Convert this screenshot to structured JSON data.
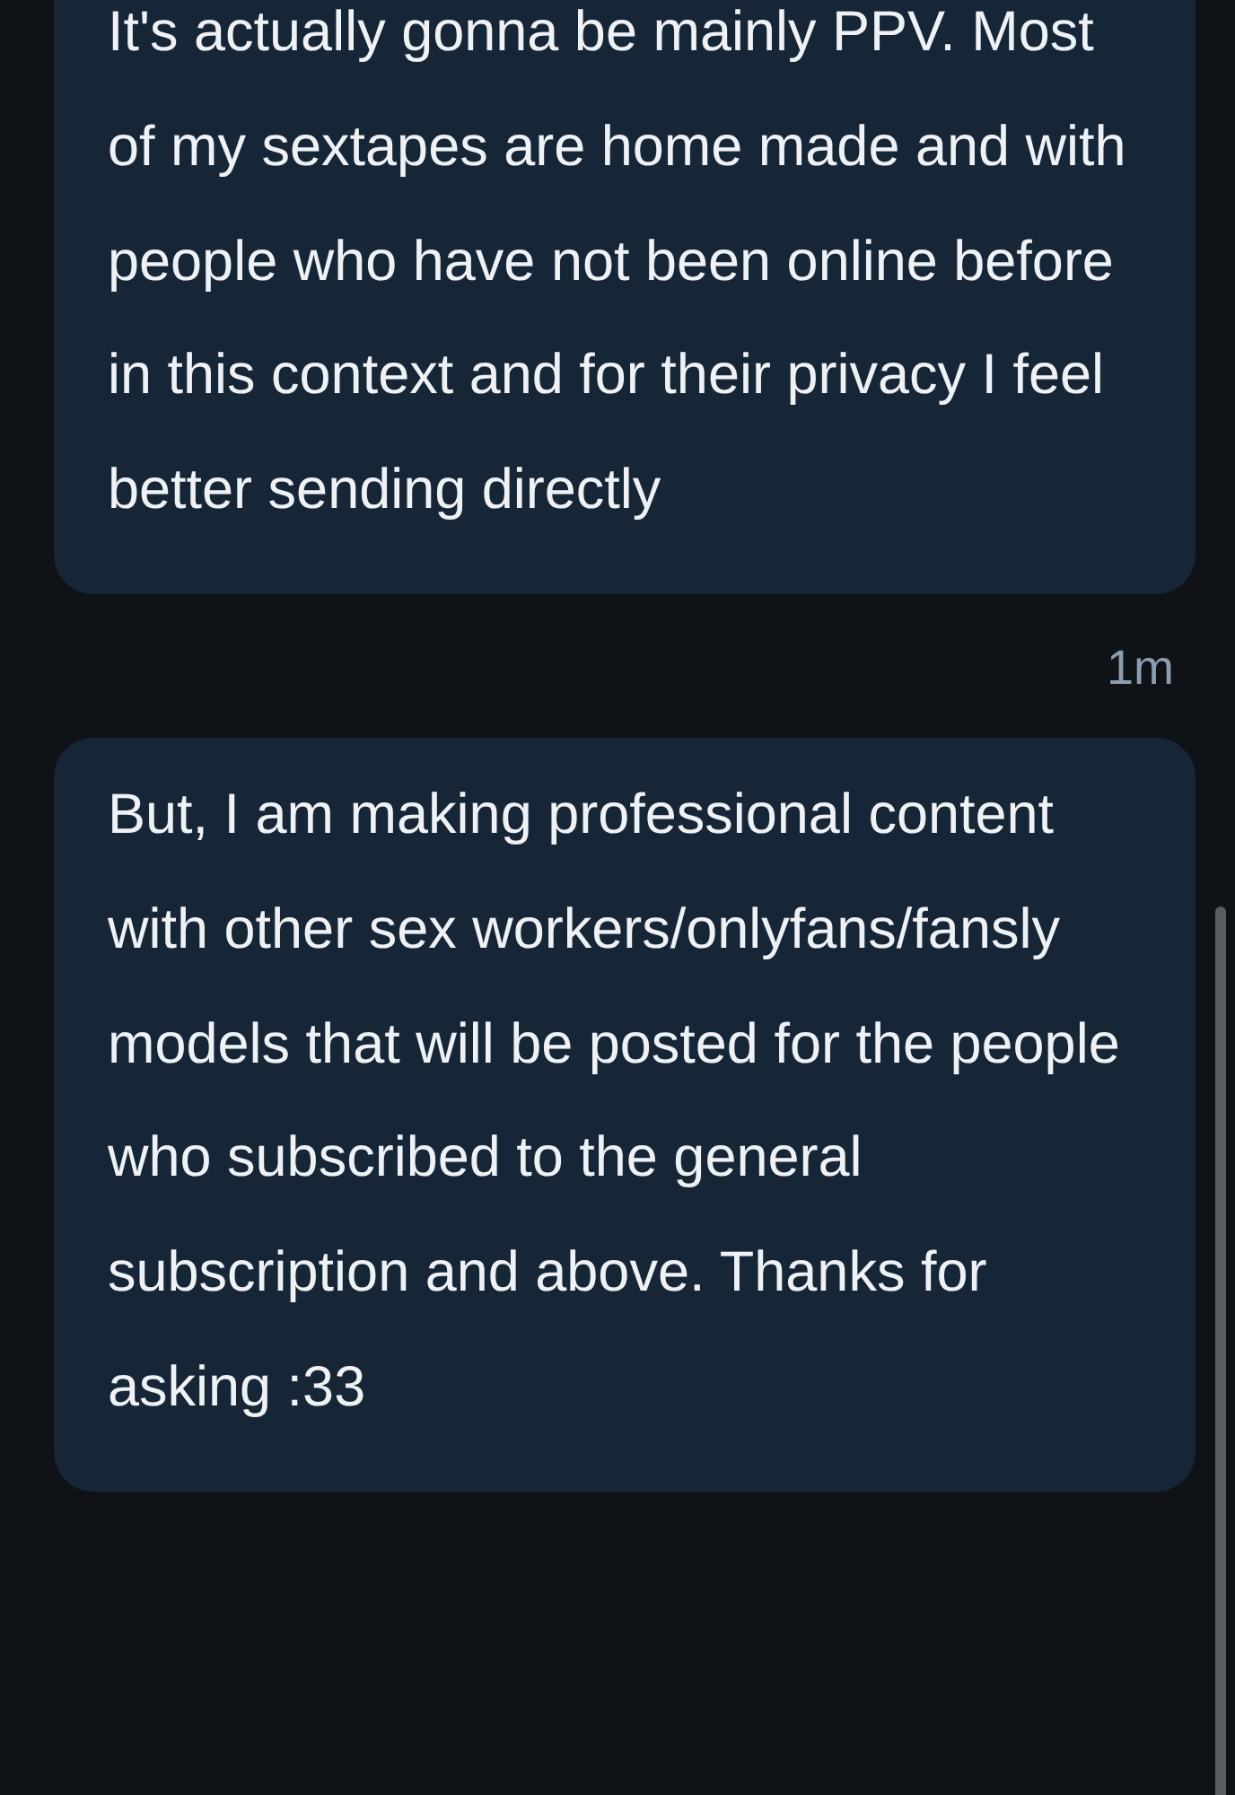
{
  "conversation": [
    {
      "kind": "message",
      "text": "It's actually gonna be mainly PPV. Most of my sextapes are home made and with people who have not been online before in this context and for their privacy I feel better sending directly"
    },
    {
      "kind": "time",
      "text": "1m"
    },
    {
      "kind": "message",
      "text": "But, I am making professional content with other sex workers/onlyfans/fansly models that will be posted for the people who subscribed to the general subscription and above. Thanks for asking :33"
    }
  ]
}
